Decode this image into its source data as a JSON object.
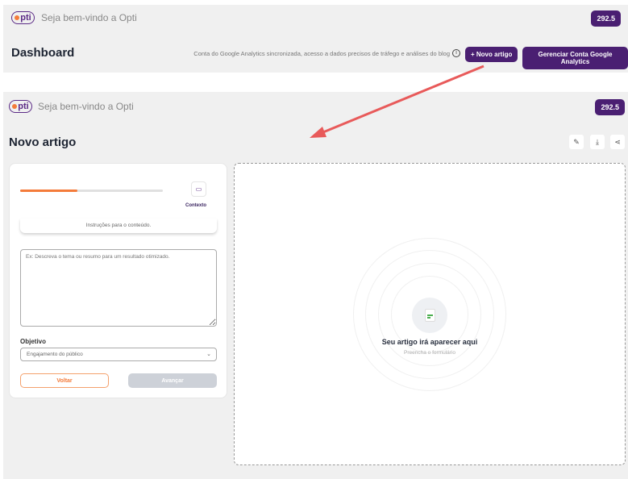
{
  "top": {
    "welcome": "Seja bem-vindo a Opti",
    "credits": "292.5",
    "title": "Dashboard",
    "ga_note": "Conta do Google Analytics sincronizada, acesso a dados precisos de tráfego e análises do blog",
    "new_article": "+ Novo artigo",
    "manage_ga": "Gerenciar Conta Google Analytics"
  },
  "main": {
    "welcome": "Seja bem-vindo a Opti",
    "credits": "292.5",
    "title": "Novo artigo",
    "form": {
      "progress_percent": 40,
      "step_label": "Contexto",
      "instructions": "Instruções para o conteúdo.",
      "textarea_placeholder": "Ex: Descreva o tema ou resumo para um resultado otimizado.",
      "objective_label": "Objetivo",
      "objective_value": "Engajamento do público",
      "back": "Voltar",
      "next": "Avançar"
    },
    "preview": {
      "title": "Seu artigo irá aparecer aqui",
      "subtitle": "Preencha o formulário"
    }
  },
  "colors": {
    "brand": "#4a1f72",
    "accent": "#f47b3a",
    "arrow": "#e85a5a"
  }
}
